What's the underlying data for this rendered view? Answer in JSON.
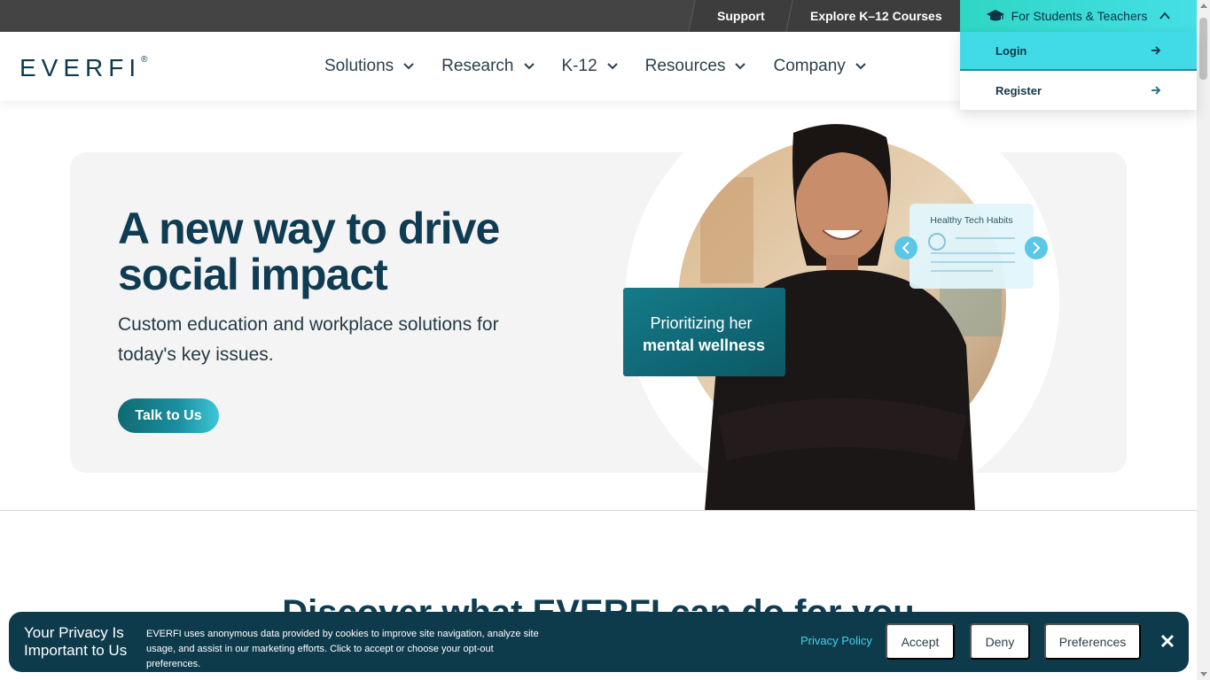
{
  "topbar": {
    "support": "Support",
    "explore": "Explore K–12 Courses",
    "students_teachers": "For Students & Teachers"
  },
  "header": {
    "logo": "EVERFI",
    "logo_mark": "®",
    "nav": [
      {
        "label": "Solutions"
      },
      {
        "label": "Research"
      },
      {
        "label": "K-12"
      },
      {
        "label": "Resources"
      },
      {
        "label": "Company"
      }
    ]
  },
  "dropdown": {
    "login": "Login",
    "register": "Register"
  },
  "hero": {
    "title": "A new way to drive social impact",
    "subtitle": "Custom education and workplace solutions for today's key issues.",
    "cta": "Talk to Us",
    "card_label_1": "Prioritizing her",
    "card_label_2": "mental wellness",
    "tile_title": "Healthy Tech Habits"
  },
  "discover": {
    "heading": "Discover what EVERFI can do for you"
  },
  "cookie": {
    "title": "Your Privacy Is Important to Us",
    "text": "EVERFI uses anonymous data provided by cookies to improve site navigation, analyze site usage, and assist in our marketing efforts. Click to accept or choose your opt-out preferences.",
    "privacy_link": "Privacy Policy",
    "accept": "Accept",
    "deny": "Deny",
    "preferences": "Preferences"
  },
  "colors": {
    "brand_navy": "#0f3c52",
    "accent_teal": "#41dbe8",
    "cookie_bg": "#0e3b4c"
  }
}
